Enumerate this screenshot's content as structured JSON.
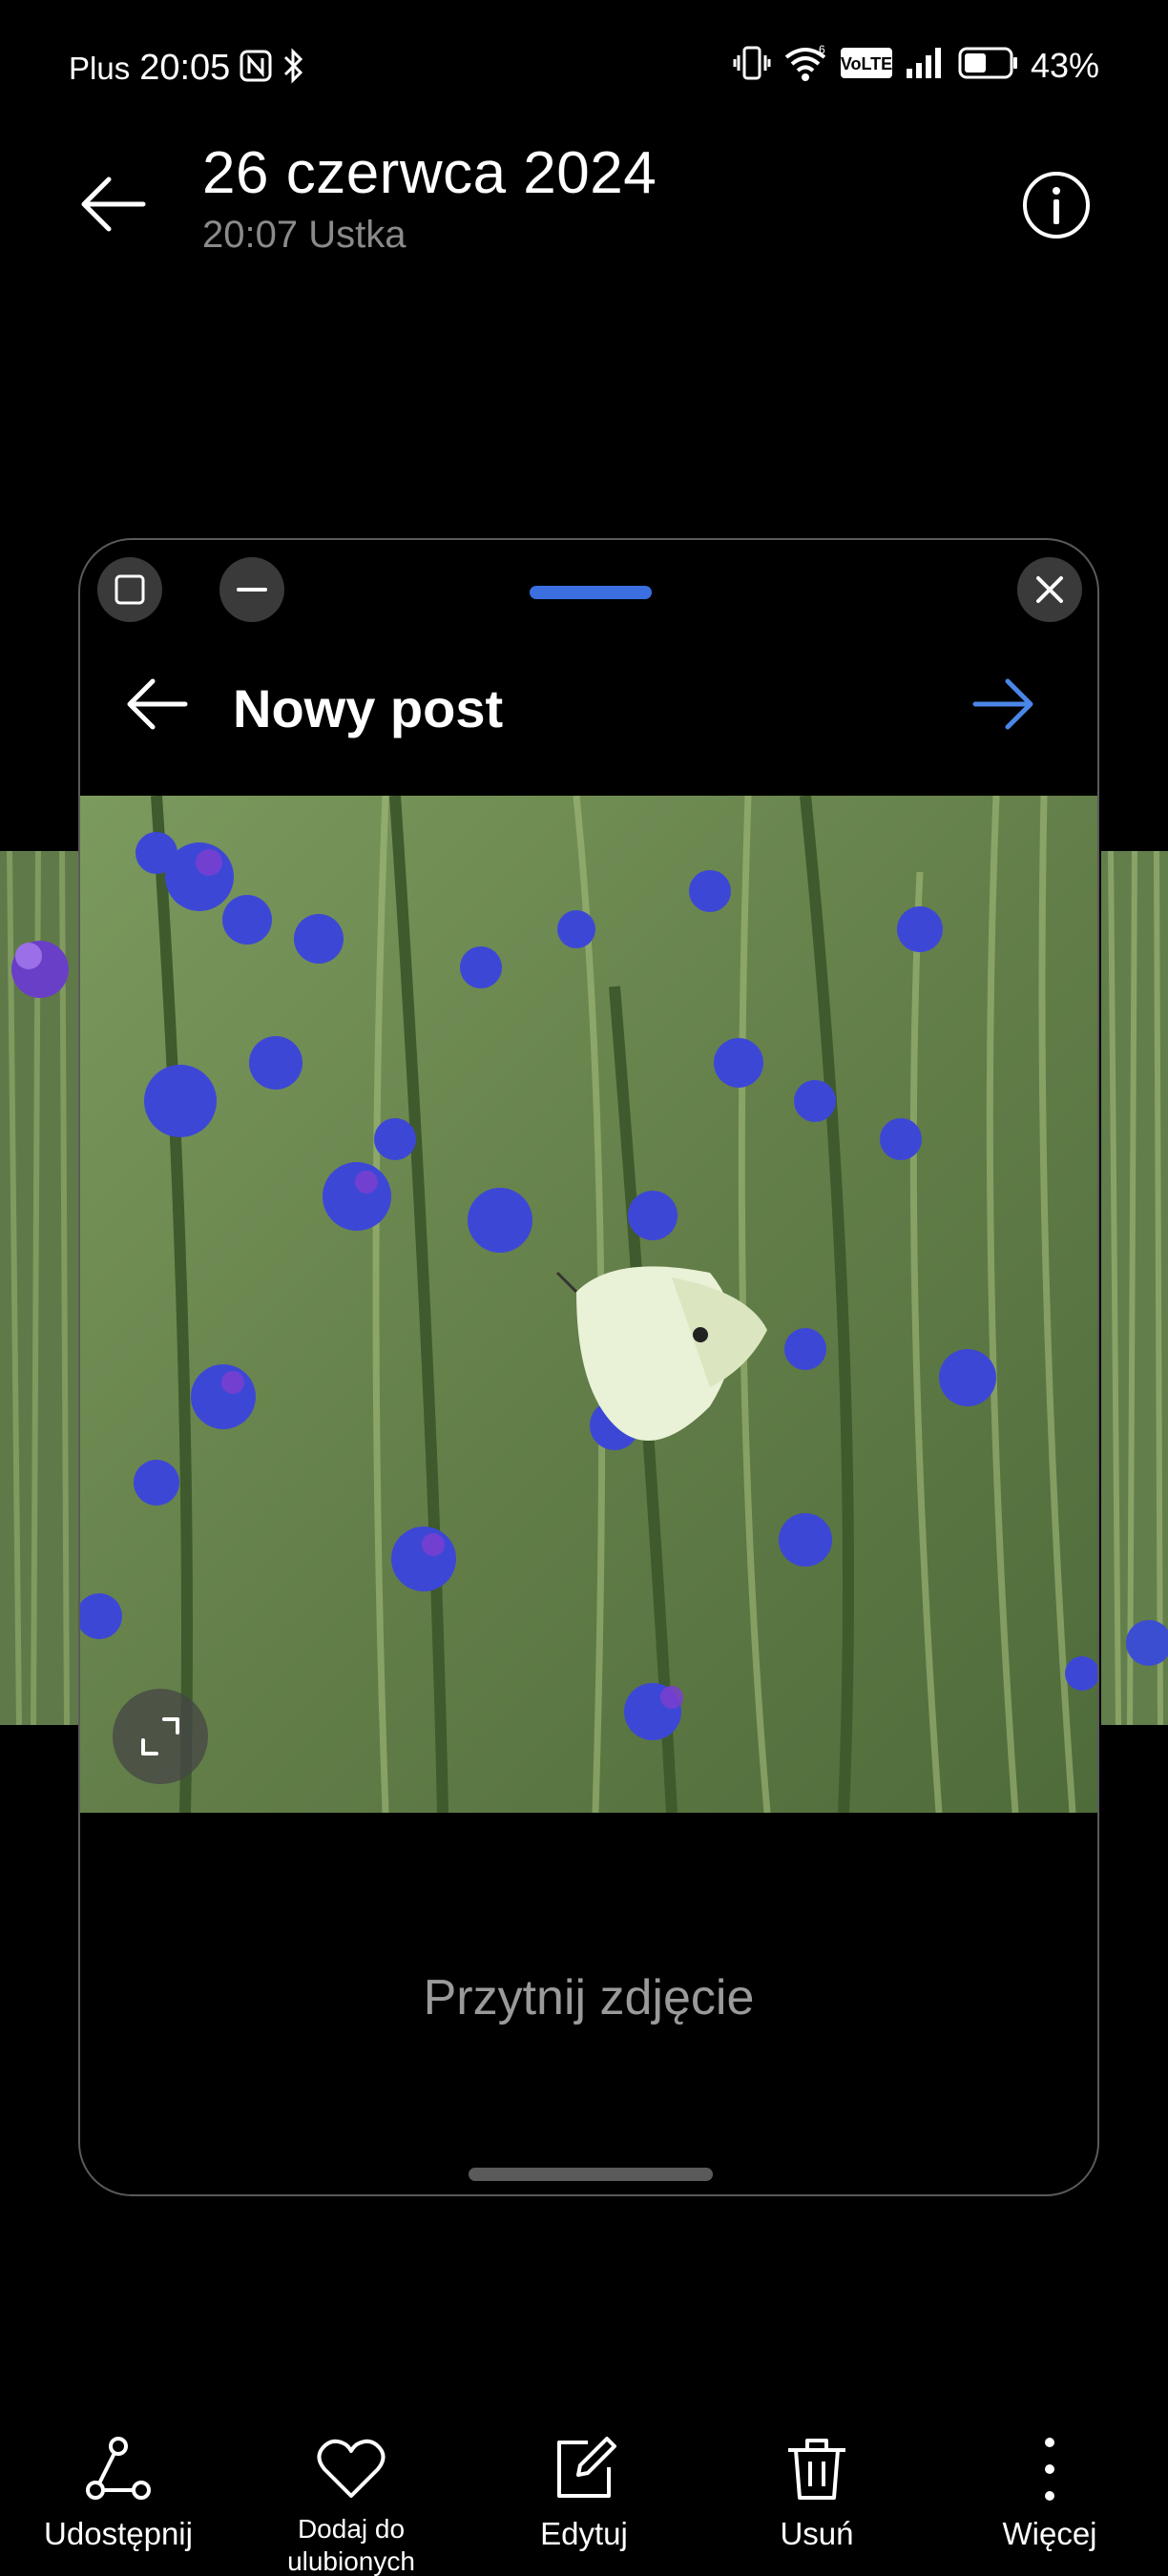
{
  "status_bar": {
    "carrier": "Plus",
    "time": "20:05",
    "network_label": "VoLTE",
    "network_gen": "6",
    "battery_percent": "43%",
    "icons": [
      "nfc-icon",
      "bluetooth-icon",
      "vibrate-icon",
      "wifi-icon",
      "volte-icon",
      "signal-icon",
      "battery-icon"
    ]
  },
  "header": {
    "title": "26 czerwca 2024",
    "subtitle": "20:07 Ustka",
    "back_icon": "arrow-left-icon",
    "info_icon": "info-icon"
  },
  "floating_window": {
    "accent_color": "#3b6fe0",
    "controls": [
      "maximize-icon",
      "minimize-icon",
      "close-icon"
    ],
    "post_title": "Nowy post",
    "next_icon": "arrow-right-icon",
    "expand_icon": "expand-icon",
    "crop_label": "Przytnij zdjęcie"
  },
  "toolbar": {
    "items": [
      {
        "label": "Udostępnij",
        "icon": "share-icon"
      },
      {
        "label": "Dodaj do ulubionych",
        "icon": "heart-icon"
      },
      {
        "label": "Edytuj",
        "icon": "edit-icon"
      },
      {
        "label": "Usuń",
        "icon": "trash-icon"
      },
      {
        "label": "Więcej",
        "icon": "more-vertical-icon"
      }
    ]
  }
}
